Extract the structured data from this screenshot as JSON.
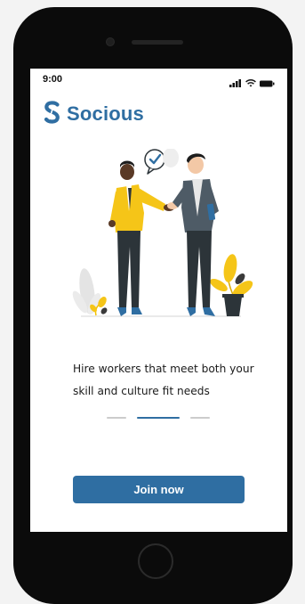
{
  "status_bar": {
    "time": "9:00",
    "icons": [
      "cellular-signal-icon",
      "wifi-icon",
      "battery-icon"
    ]
  },
  "brand": {
    "name": "Socious",
    "logo_icon": "socious-logo-icon",
    "color": "#2f6ea2"
  },
  "illustration": {
    "name": "handshake-illustration",
    "badge_icon": "checkmark-icon"
  },
  "onboarding": {
    "headline": "Hire workers that meet both your skill and culture fit needs",
    "pages_total": 3,
    "active_page": 2
  },
  "cta": {
    "label": "Join now"
  },
  "colors": {
    "accent": "#2f6ea2",
    "accent_yellow": "#f5c518",
    "dark": "#2c3439"
  }
}
